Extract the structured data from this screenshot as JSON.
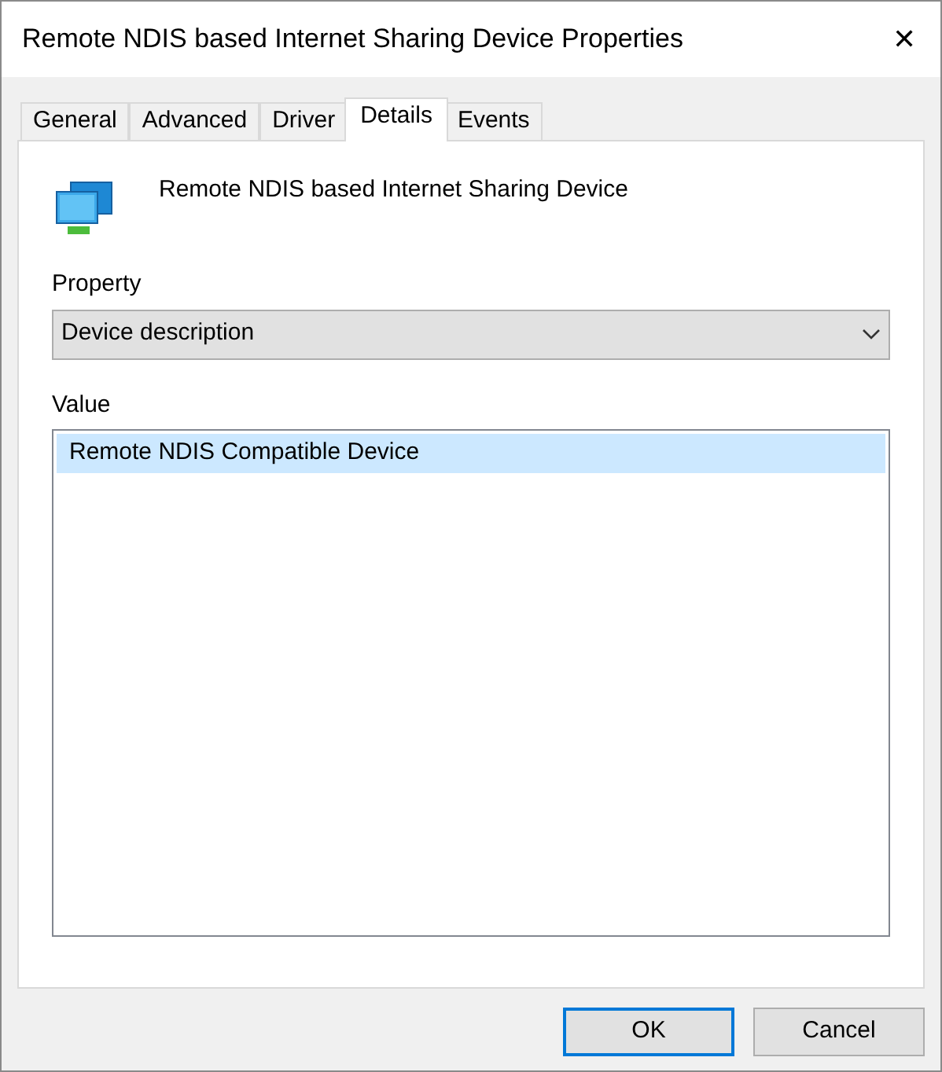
{
  "window": {
    "title": "Remote NDIS based Internet Sharing Device Properties",
    "close": "✕"
  },
  "tabs": [
    {
      "label": "General",
      "selected": false
    },
    {
      "label": "Advanced",
      "selected": false
    },
    {
      "label": "Driver",
      "selected": false
    },
    {
      "label": "Details",
      "selected": true
    },
    {
      "label": "Events",
      "selected": false
    }
  ],
  "device": {
    "name": "Remote NDIS based Internet Sharing Device"
  },
  "property": {
    "label": "Property",
    "value": "Device description"
  },
  "value": {
    "label": "Value",
    "items": [
      {
        "text": "Remote NDIS Compatible Device",
        "selected": true
      }
    ]
  },
  "buttons": [
    {
      "label": "OK",
      "default": true
    },
    {
      "label": "Cancel",
      "default": false
    }
  ]
}
